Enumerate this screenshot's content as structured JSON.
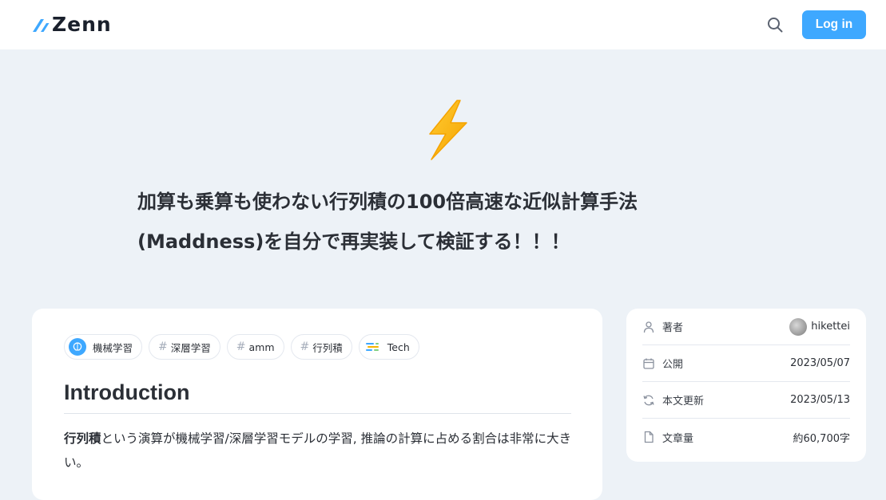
{
  "header": {
    "logo_text": "Zenn",
    "search_icon": "search-icon",
    "login_label": "Log in",
    "accent_color": "#3ea8ff"
  },
  "article": {
    "emoji": "high-voltage-icon",
    "title": "加算も乗算も使わない行列積の100倍高速な近似計算手法(Maddness)を自分で再実装して検証する！！！",
    "tags": [
      {
        "label": "機械学習",
        "icon": "brain-icon"
      },
      {
        "label": "深層学習",
        "icon": "hash"
      },
      {
        "label": "amm",
        "icon": "hash"
      },
      {
        "label": "行列積",
        "icon": "hash"
      },
      {
        "label": "Tech",
        "icon": "code-icon"
      }
    ],
    "heading": "Introduction",
    "paragraph_bold": "行列積",
    "paragraph_rest": "という演算が機械学習/深層学習モデルの学習, 推論の計算に占める割合は非常に大きい。"
  },
  "info": {
    "author_label": "著者",
    "author_name": "hikettei",
    "published_label": "公開",
    "published_date": "2023/05/07",
    "updated_label": "本文更新",
    "updated_date": "2023/05/13",
    "length_label": "文章量",
    "length_value": "約60,700字"
  }
}
